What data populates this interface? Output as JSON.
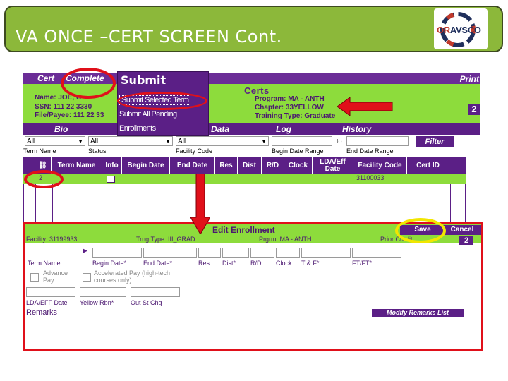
{
  "banner": {
    "title": "VA ONCE –CERT SCREEN Cont."
  },
  "logo": {
    "text_or": "OR",
    "text_rest": "AVSCO"
  },
  "top_tabs": {
    "cert": "Cert",
    "complete": "Complete",
    "print": "Print"
  },
  "submit_menu": {
    "title": "Submit",
    "items": [
      "Submit Selected Term",
      "Submit All Pending",
      "Enrollments"
    ]
  },
  "certs": {
    "title": "Certs",
    "name": "Name: JOE, C",
    "ssn": "SSN: 111 22 3330",
    "file": "File/Payee: 111 22 33",
    "program": "Program: MA - ANTH",
    "chapter": "Chapter: 33YELLOW",
    "training": "Training Type: Graduate",
    "page": "2"
  },
  "nav": {
    "bio": "Bio",
    "data": "Data",
    "log": "Log",
    "history": "History"
  },
  "filters": {
    "term": "All",
    "status": "All",
    "facility": "All",
    "term_label": "Term Name",
    "status_label": "Status",
    "facility_label": "Facility Code",
    "begin_label": "Begin Date Range",
    "to": "to",
    "end_label": "End Date Range",
    "filter_button": "Filter"
  },
  "grid": {
    "columns": [
      "Term Name",
      "Info",
      "Begin Date",
      "End Date",
      "Res",
      "Dist",
      "R/D",
      "Clock",
      "LDA/Eff Date",
      "Facility Code",
      "Cert ID"
    ],
    "row": {
      "num": "2",
      "facility": "31100033"
    }
  },
  "edit": {
    "title": "Edit Enrollment",
    "facility": "Facility: 31199933",
    "trng": "Trng Type: III_GRAD",
    "prgrm": "Prgrm: MA - ANTH",
    "prior": "Prior Credit:",
    "page": "2",
    "save": "Save",
    "cancel": "Cancel",
    "labels": [
      "Term Name",
      "Begin Date*",
      "End Date*",
      "Res",
      "Dist*",
      "R/D",
      "Clock",
      "T & F*",
      "FT/FT*"
    ],
    "advance_pay": "Advance Pay",
    "accel_pay": "Accelerated Pay (high-tech courses only)",
    "lda_label": "LDA/EFF Date",
    "yellow_label": "Yellow Rbn*",
    "outst_label": "Out St Chg",
    "remarks": "Remarks",
    "modify_button": "Modify Remarks List"
  },
  "colors": {
    "accent_red": "#e0101a",
    "accent_yellow": "#f2e600",
    "purple": "#5b1f86",
    "green": "#8ddc3c"
  }
}
